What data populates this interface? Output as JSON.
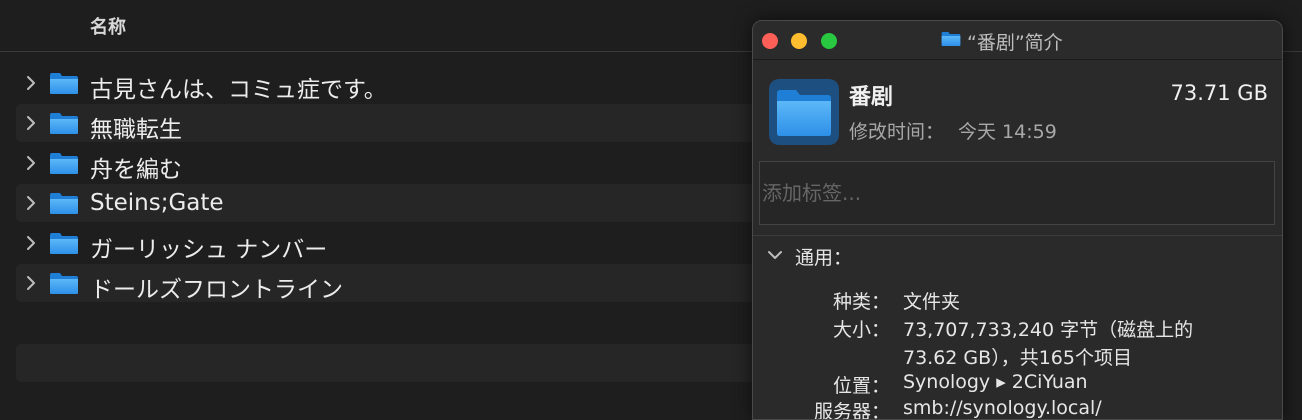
{
  "finder": {
    "column_header": "名称",
    "rows": [
      {
        "label": "古見さんは、コミュ症です。"
      },
      {
        "label": "無職転生"
      },
      {
        "label": "舟を編む"
      },
      {
        "label": "Steins;Gate"
      },
      {
        "label": "ガーリッシュ ナンバー"
      },
      {
        "label": "ドールズフロントライン"
      }
    ]
  },
  "info_window": {
    "title": "“番剧”简介",
    "name": "番剧",
    "size": "73.71 GB",
    "modified_label": "修改时间：",
    "modified_value": "今天 14:59",
    "tags_placeholder": "添加标签...",
    "section_label": "通用：",
    "props": {
      "kind_key": "种类：",
      "kind_val": "文件夹",
      "size_key": "大小：",
      "size_val_line1": "73,707,733,240 字节（磁盘上的",
      "size_val_line2": "73.62 GB），共165个项目",
      "where_key": "位置：",
      "where_val": "Synology ▸ 2CiYuan",
      "server_key": "服务器：",
      "server_val": "smb://synology.local/"
    }
  },
  "colors": {
    "folder_blue": "#3ea6f5",
    "folder_dark": "#1f7fd6",
    "close": "#ff5f57",
    "minimize": "#febc2e",
    "zoom": "#28c840"
  }
}
